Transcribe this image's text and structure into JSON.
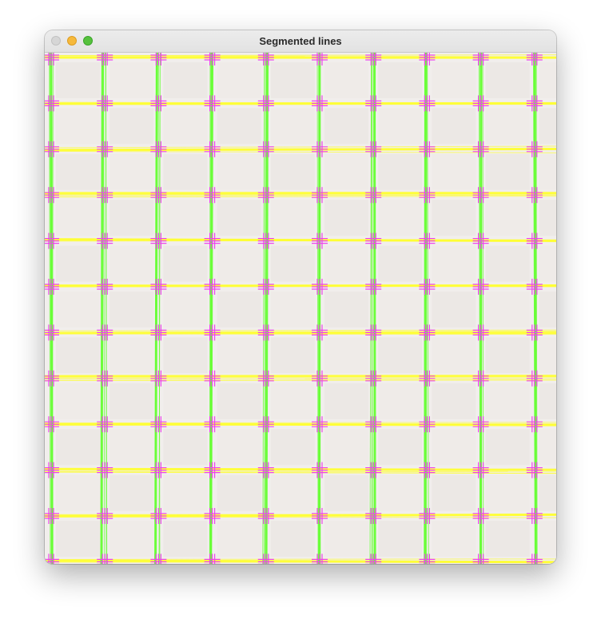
{
  "window": {
    "title": "Segmented lines",
    "buttons": {
      "close": "close",
      "minimize": "minimize",
      "zoom": "zoom"
    }
  },
  "canvas": {
    "description_colors": {
      "background": "#f1eeec",
      "vertical_lines": "#66ff33",
      "horizontal_lines": "#ffff33",
      "intersections": "#ee44ee"
    },
    "grid": {
      "vertical_count": 10,
      "horizontal_count": 12
    }
  }
}
